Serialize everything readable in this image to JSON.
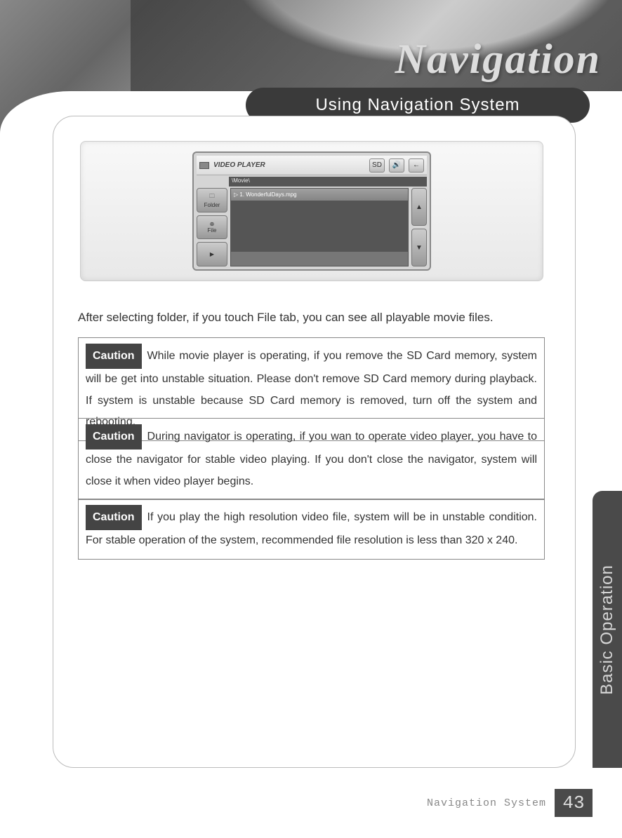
{
  "header": {
    "brand": "Navigation",
    "section_title": "Using Navigation System"
  },
  "screenshot": {
    "app_title": "VIDEO PLAYER",
    "path": "\\Movie\\",
    "side_buttons": {
      "folder": "Folder",
      "file": "File",
      "play": "▶"
    },
    "titlebar_icons": {
      "sd": "SD",
      "speaker": "🔊",
      "back": "←"
    },
    "scroll": {
      "up": "▲",
      "down": "▼"
    },
    "list_item": "▷ 1. WonderfulDays.mpg"
  },
  "intro": "After selecting folder, if you touch File tab, you can see all playable movie files.",
  "cautions": {
    "label": "Caution",
    "c1": "While movie player is operating, if you remove the SD Card memory, system will be get into unstable situation. Please don't remove SD Card memory during playback. If system is unstable because SD Card memory is removed, turn off the system and rebooting.",
    "c2": "During navigator is operating, if you wan to operate video player, you have to close the navigator for stable video playing. If you don't close the navigator, system will close it when video player begins.",
    "c3": "If you play the high resolution video file, system will be in unstable condition. For stable operation of the system, recommended file resolution is less than 320 x 240."
  },
  "side_tab": "Basic Operation",
  "footer": {
    "label": "Navigation System",
    "page": "43"
  }
}
